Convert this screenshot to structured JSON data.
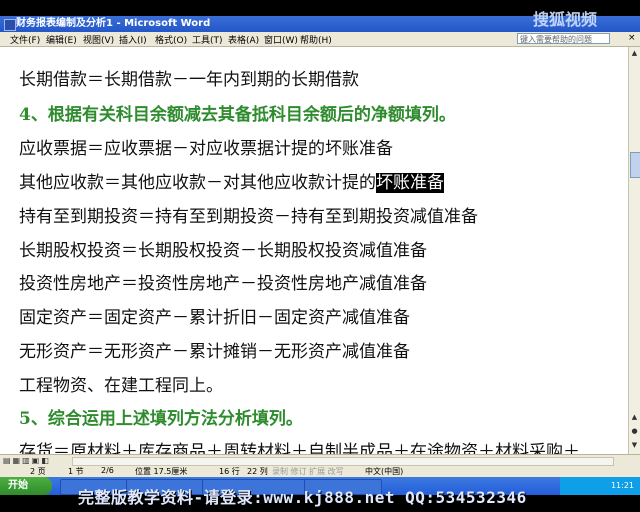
{
  "window": {
    "title": "财务报表编制及分析1 - Microsoft Word",
    "brand": "搜狐视频"
  },
  "menu": {
    "items": [
      "文件(F)",
      "编辑(E)",
      "视图(V)",
      "插入(I)",
      "格式(O)",
      "工具(T)",
      "表格(A)",
      "窗口(W)",
      "帮助(H)"
    ],
    "help_placeholder": "键入需要帮助的问题",
    "close": "×"
  },
  "document": {
    "lines": [
      "长期借款＝长期借款－一年内到期的长期借款",
      "4、根据有关科目余额减去其备抵科目余额后的净额填列。",
      "应收票据＝应收票据－对应收票据计提的坏账准备",
      "其他应收款＝其他应收款－对其他应收款计提的",
      "坏账准备",
      "持有至到期投资＝持有至到期投资－持有至到期投资减值准备",
      "长期股权投资＝长期股权投资－长期股权投资减值准备",
      "投资性房地产＝投资性房地产－投资性房地产减值准备",
      "固定资产＝固定资产－累计折旧－固定资产减值准备",
      "无形资产＝无形资产－累计摊销－无形资产减值准备",
      "工程物资、在建工程同上。",
      "5、综合运用上述填列方法分析填列。",
      "存货＝原材料＋库存商品＋周转材料＋自制半成品＋在途物资＋材料采购＋"
    ]
  },
  "statusbar": {
    "page": "2 页",
    "section": "1 节",
    "pages": "2/6",
    "position": "位置 17.5厘米",
    "line": "16 行",
    "column": "22 列",
    "modes": "录制 修订 扩展 改写",
    "language": "中文(中国)"
  },
  "taskbar": {
    "start": "开始",
    "clock": "11:21",
    "buttons": [
      "",
      "",
      "",
      ""
    ]
  },
  "overlay": {
    "watermark": "完整版教学资料-请登录:www.kj888.net QQ:534532346"
  }
}
